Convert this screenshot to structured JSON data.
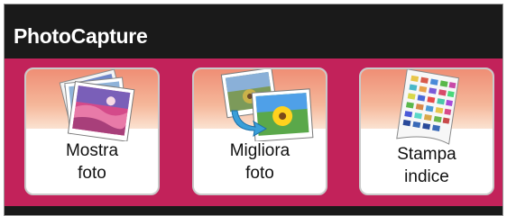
{
  "title_bar": {
    "title": "PhotoCapture"
  },
  "colors": {
    "band": "#c2225a",
    "title_bar": "#1a1a1a",
    "card_gradient_top": "#ef8e75",
    "card_gradient_bottom": "#fbe3d2"
  },
  "buttons": [
    {
      "line1": "Mostra",
      "line2": "foto",
      "icon": "photo-stack-icon"
    },
    {
      "line1": "Migliora",
      "line2": "foto",
      "icon": "enhance-photo-icon"
    },
    {
      "line1": "Stampa",
      "line2": "indice",
      "icon": "index-print-icon"
    }
  ]
}
